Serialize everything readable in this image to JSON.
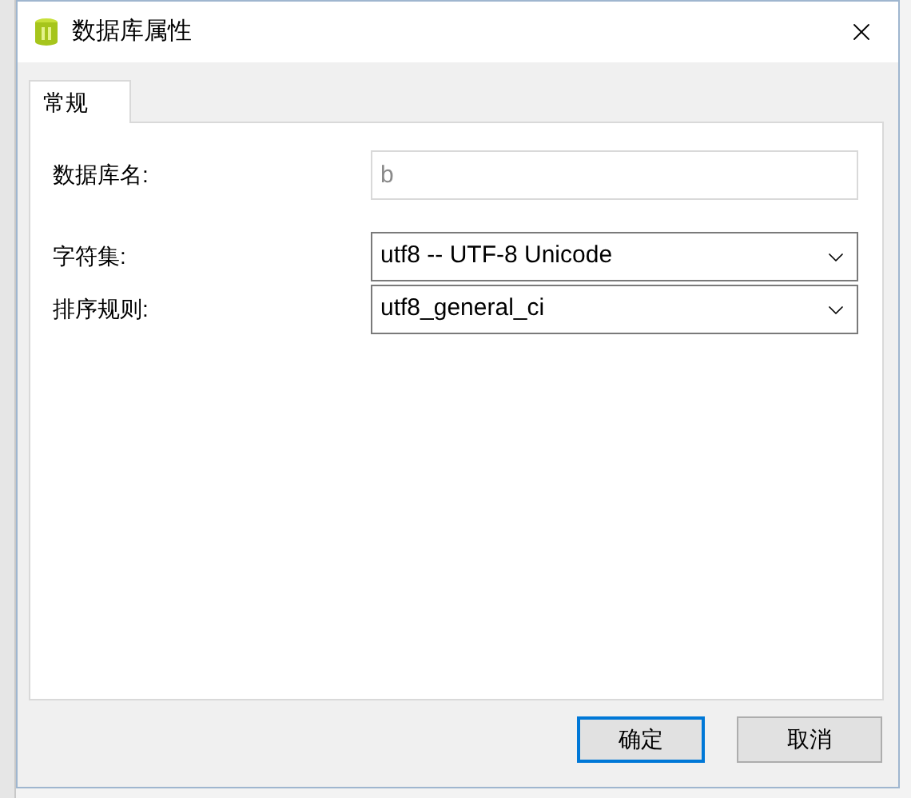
{
  "window": {
    "title": "数据库属性"
  },
  "tabs": [
    {
      "label": "常规",
      "selected": true
    }
  ],
  "fields": [
    {
      "kind": "text",
      "label": "数据库名:",
      "value": "b",
      "disabled": true
    },
    {
      "kind": "select",
      "label": "字符集:",
      "value": "utf8 -- UTF-8 Unicode",
      "disabled": false
    },
    {
      "kind": "select",
      "label": "排序规则:",
      "value": "utf8_general_ci",
      "disabled": false
    }
  ],
  "buttons": [
    {
      "label": "确定",
      "default": true
    },
    {
      "label": "取消",
      "default": false
    }
  ]
}
